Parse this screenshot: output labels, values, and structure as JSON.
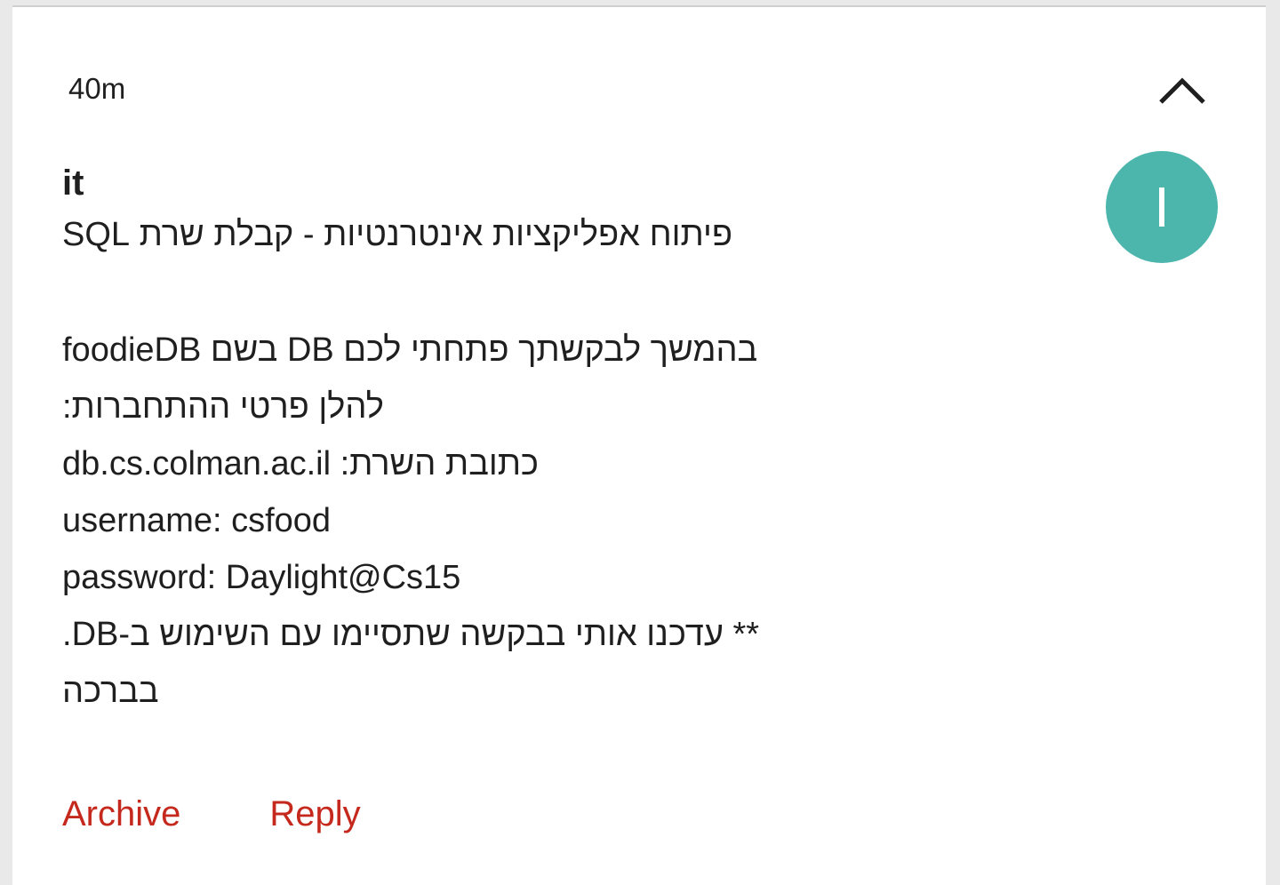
{
  "message": {
    "timestamp": "40m",
    "sender": "it",
    "avatar_letter": "I",
    "subject": "פיתוח אפליקציות אינטרנטיות - קבלת שרת SQL",
    "body_lines": [
      "בהמשך לבקשתך פתחתי לכם DB בשם  foodieDB",
      "להלן פרטי ההתחברות:",
      "כתובת השרת: db.cs.colman.ac.il",
      "username: csfood",
      "password: Daylight@Cs15",
      "** עדכנו אותי בבקשה שתסיימו עם השימוש ב-DB.",
      "בברכה"
    ]
  },
  "actions": {
    "archive_label": "Archive",
    "reply_label": "Reply"
  },
  "icons": {
    "collapse": "chevron-up-icon"
  },
  "colors": {
    "avatar_bg": "#4db6ac",
    "action_text": "#c5281c"
  }
}
